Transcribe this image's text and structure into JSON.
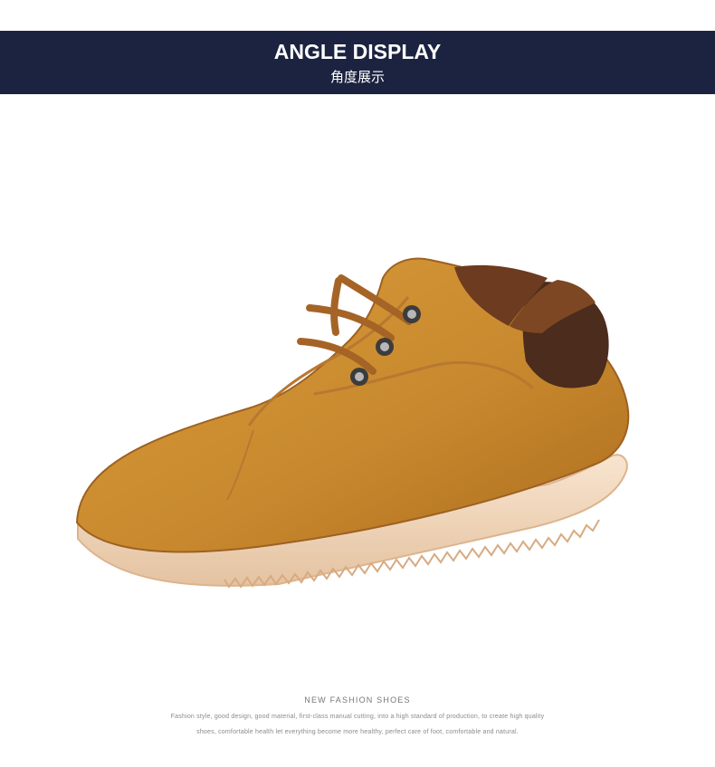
{
  "header": {
    "title": "ANGLE DISPLAY",
    "subtitle": "角度展示"
  },
  "product": {
    "image_icon": "shoe-image",
    "colors": {
      "upper": "#c98a2f",
      "upper_shadow": "#ad6d1e",
      "heel_tab": "#4b2c1d",
      "sole": "#f3d9bf",
      "lace": "#a56426"
    }
  },
  "caption": {
    "title": "NEW FASHION SHOES",
    "line1": "Fashion style, good design, good material, first-class manual cutting, into a high standard of production, to create high quality",
    "line2": "shoes, comfortable health let everything become more healthy, perfect care of foot, comfortable and natural."
  },
  "colors": {
    "banner_bg": "#1c2340",
    "banner_text": "#ffffff",
    "caption_text": "#777777"
  }
}
